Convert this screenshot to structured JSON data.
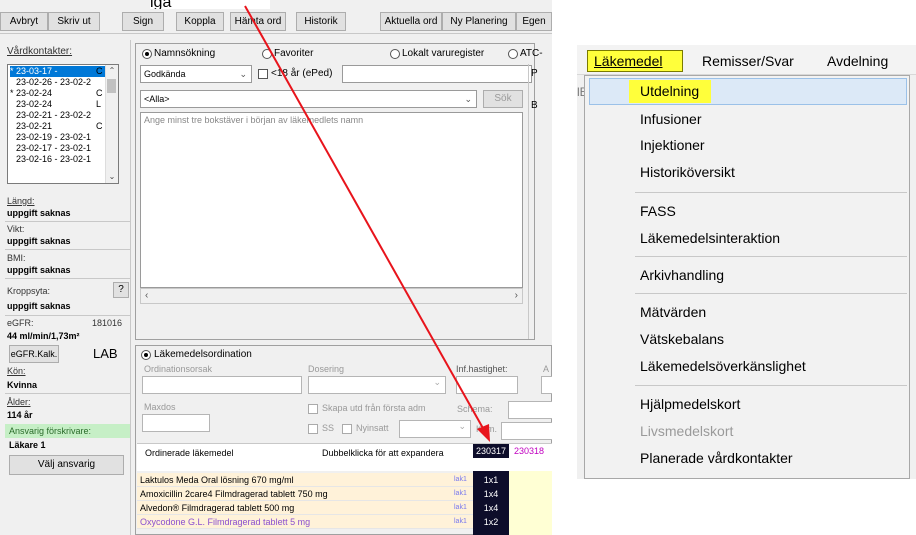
{
  "top_caption": "iga",
  "toolbar": [
    "Avbryt",
    "Skriv ut",
    "Sign",
    "Koppla",
    "Hämta ord",
    "Historik",
    "Aktuella ord",
    "Ny Planering",
    "Egen"
  ],
  "left_panel": {
    "contacts_label": "Vårdkontakter:",
    "contacts": [
      "* 23-03-17 -",
      "23-02-26 - 23-02-2",
      "* 23-02-24",
      "23-02-24",
      "23-02-21 - 23-02-2",
      "23-02-21",
      "23-02-19 - 23-02-1",
      "23-02-17 - 23-02-1",
      "23-02-16 - 23-02-1"
    ],
    "contacts_suffix": [
      "C",
      "",
      "C",
      "L",
      "",
      "C",
      "",
      "",
      ""
    ],
    "length_label": "Längd:",
    "length_value": "uppgift saknas",
    "weight_label": "Vikt:",
    "weight_value": "uppgift saknas",
    "bmi_label": "BMI:",
    "bmi_value": "uppgift saknas",
    "bodysurface_label": "Kroppsyta:",
    "bodysurface_button": "?",
    "bodysurface_value": "uppgift saknas",
    "egfr_label": "eGFR:",
    "egfr_date": "181016",
    "egfr_value": "44 ml/min/1,73m²",
    "egfr_calc_button": "eGFR.Kalk.",
    "lab_label": "LAB",
    "sex_label": "Kön:",
    "sex_value": "Kvinna",
    "age_label": "Ålder:",
    "age_value": "114 år",
    "responsible_label": "Ansvarig förskrivare:",
    "responsible_value": "Läkare 1",
    "choose_responsible_button": "Välj ansvarig"
  },
  "search_pane": {
    "radios": [
      "Namnsökning",
      "Favoriter",
      "Lokalt varuregister",
      "ATC-"
    ],
    "approved_select": "Godkända",
    "under18_label": "<18 år (ePed)",
    "all_select": "<Alla>",
    "search_button": "Sök",
    "hint": "Ange minst tre bokstäver i början av läkemedlets namn",
    "right_letters": [
      "P",
      "B"
    ]
  },
  "order_pane": {
    "title": "Läkemedelsordination",
    "reason_label": "Ordinationsorsak",
    "dosage_label": "Dosering",
    "infusion_label": "Inf.hastighet:",
    "a_label": "A",
    "maxdos_label": "Maxdos",
    "create_distribution_label": "Skapa utd från första adm",
    "schema_label": "Schema:",
    "ss_label": "SS",
    "new_label": "Nyinsatt",
    "kom_label": "Kom.",
    "ordered_header": "Ordinerade läkemedel",
    "expand_hint": "Dubbelklicka för att expandera",
    "date_cols": [
      "230317",
      "230318"
    ],
    "rows": [
      {
        "name": "Laktulos Meda Oral lösning 670 mg/ml",
        "tag": "lak1",
        "dose": "1x1"
      },
      {
        "name": "Amoxicillin 2care4 Filmdragerad tablett 750 mg",
        "tag": "lak1",
        "dose": "1x4"
      },
      {
        "name": "Alvedon® Filmdragerad tablett 500 mg",
        "tag": "lak1",
        "dose": "1x4"
      },
      {
        "name": "Oxycodone G.L. Filmdragerad tablett 5 mg",
        "tag": "lak1",
        "dose": "1x2"
      }
    ]
  },
  "colors": {
    "arrow": "#e8141c",
    "highlight": "#ffff3b",
    "ordered_row": "#fff2d9",
    "opioid_text": "#8a4fcf",
    "dark_cell": "#0d0d2a"
  },
  "menu": {
    "menubar": [
      "Läkemedel",
      "Remisser/Svar",
      "Avdelning"
    ],
    "items": [
      {
        "label": "Utdelning"
      },
      {
        "label": "Infusioner"
      },
      {
        "label": "Injektioner"
      },
      {
        "label": "Historiköversikt"
      },
      {
        "label": "FASS"
      },
      {
        "label": "Läkemedelsinteraktion"
      },
      {
        "label": "Arkivhandling"
      },
      {
        "label": "Mätvärden"
      },
      {
        "label": "Vätskebalans"
      },
      {
        "label": "Läkemedelsöverkänslighet"
      },
      {
        "label": "Hjälpmedelskort"
      },
      {
        "label": "Livsmedelskort"
      },
      {
        "label": "Planerade vårdkontakter"
      }
    ]
  }
}
